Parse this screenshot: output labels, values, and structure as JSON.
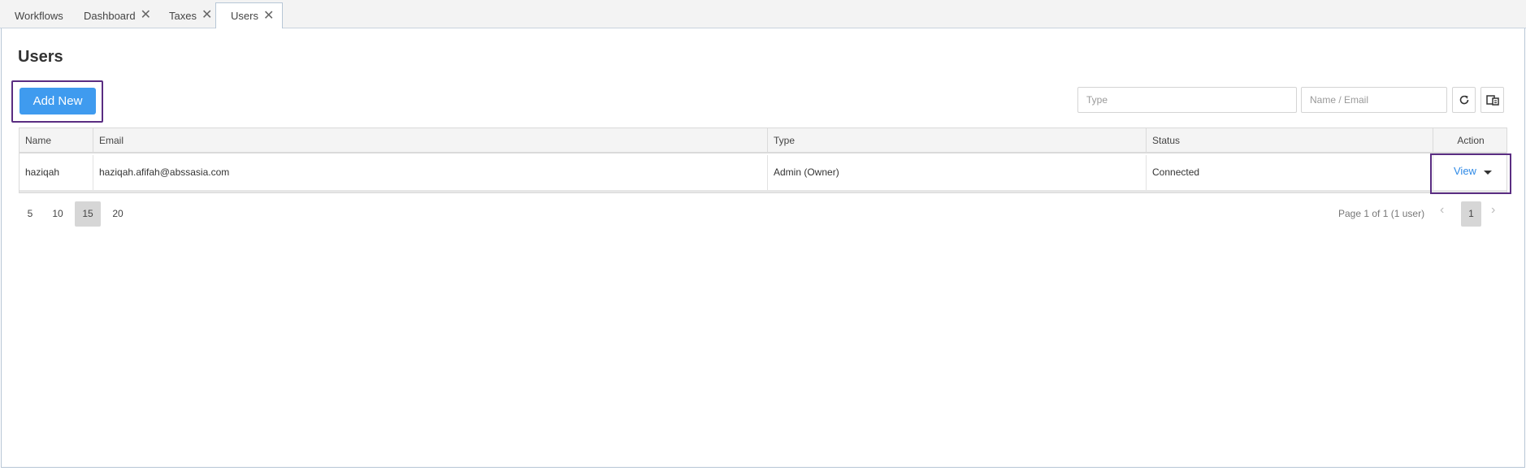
{
  "tabs": [
    {
      "label": "Workflows",
      "closable": false
    },
    {
      "label": "Dashboard",
      "closable": true
    },
    {
      "label": "Taxes",
      "closable": true
    },
    {
      "label": "Users",
      "closable": true,
      "active": true
    }
  ],
  "close_glyph": "✕",
  "page": {
    "title": "Users"
  },
  "toolbar": {
    "add_new_label": "Add New",
    "type_placeholder": "Type",
    "name_email_placeholder": "Name / Email",
    "refresh_icon": "refresh-icon",
    "columns_icon": "columns-icon"
  },
  "table": {
    "headers": {
      "name": "Name",
      "email": "Email",
      "type": "Type",
      "status": "Status",
      "action": "Action"
    },
    "rows": [
      {
        "name": "haziqah",
        "email": "haziqah.afifah@abssasia.com",
        "type": "Admin (Owner)",
        "status": "Connected",
        "action": "View"
      }
    ]
  },
  "pagination": {
    "page_sizes": [
      "5",
      "10",
      "15",
      "20"
    ],
    "selected_page_size": "15",
    "info": "Page 1 of 1 (1 user)",
    "current_page": "1"
  },
  "colors": {
    "accent": "#3f9bef",
    "highlight_border": "#5a2d82",
    "link": "#2f8ae6"
  }
}
